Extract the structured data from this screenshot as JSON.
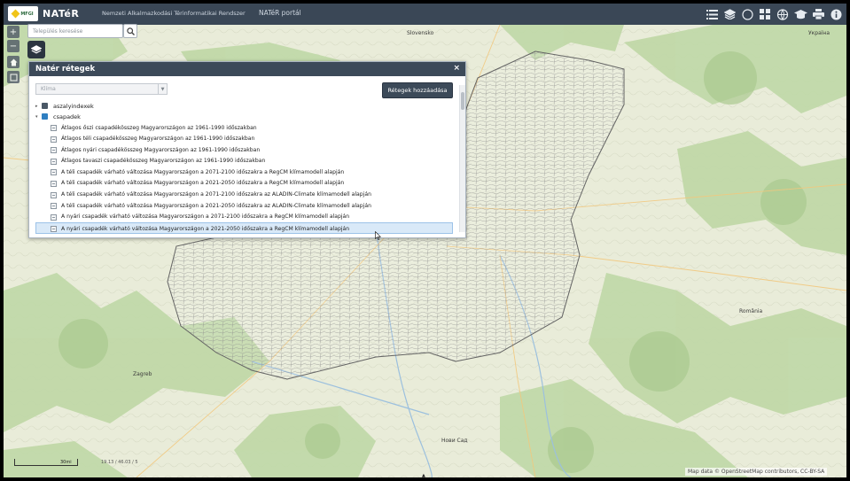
{
  "topbar": {
    "logo_text": "MFGI",
    "brand": "NATéR",
    "subtitle": "Nemzeti Alkalmazkodási Térinformatikai Rendszer",
    "portal_link": "NATéR portál",
    "icons": [
      "list-icon",
      "layers-icon",
      "globe-compass-icon",
      "grid-icon",
      "network-globe-icon",
      "graduation-cap-icon",
      "print-icon",
      "info-icon"
    ]
  },
  "search": {
    "placeholder": "Település keresése"
  },
  "map": {
    "labels": {
      "slovensko": "Slovensko",
      "ukraine": "Україна",
      "zagreb": "Zagreb",
      "novi_sad": "Нови Сад",
      "romania": "România"
    },
    "scale_label": "30mi",
    "coords": "19.13 / 46.03 / 5",
    "attribution": "Map data © OpenStreetMap contributors, CC-BY-SA"
  },
  "panel": {
    "title": "Natér rétegek",
    "close": "×",
    "select_value": "Klíma",
    "add_button": "Rétegek hozzáadása",
    "groups": [
      {
        "label": "aszalyindexek",
        "caret": "▸",
        "color": "#4a5866"
      },
      {
        "label": "csapadek",
        "caret": "▾",
        "color": "#2f7fc1"
      }
    ],
    "items": [
      "Átlagos őszi csapadékösszeg Magyarországon az 1961-1990 időszakban",
      "Átlagos téli csapadékösszeg Magyarországon az 1961-1990 időszakban",
      "Átlagos nyári csapadékösszeg Magyarországon az 1961-1990 időszakban",
      "Átlagos tavaszi csapadékösszeg Magyarországon az 1961-1990 időszakban",
      "A téli csapadék várható változása Magyarországon a 2071-2100 időszakra a RegCM klímamodell alapján",
      "A téli csapadék várható változása Magyarországon a 2021-2050 időszakra a RegCM klímamodell alapján",
      "A téli csapadék várható változása Magyarországon a 2071-2100 időszakra az ALADIN-Climate klímamodell alapján",
      "A téli csapadék várható változása Magyarországon a 2021-2050 időszakra az ALADIN-Climate klímamodell alapján",
      "A nyári csapadék várható változása Magyarországon a 2071-2100 időszakra a RegCM klímamodell alapján",
      "A nyári csapadék várható változása Magyarországon a 2021-2050 időszakra a RegCM klímamodell alapján"
    ]
  },
  "colors": {
    "topbar": "#3a4756",
    "panel_header": "#3c4a59",
    "selection": "#d9e9f8",
    "map_land": "#e8ecd8",
    "forest": "#b9d4a0",
    "border": "#5a5a5a"
  }
}
